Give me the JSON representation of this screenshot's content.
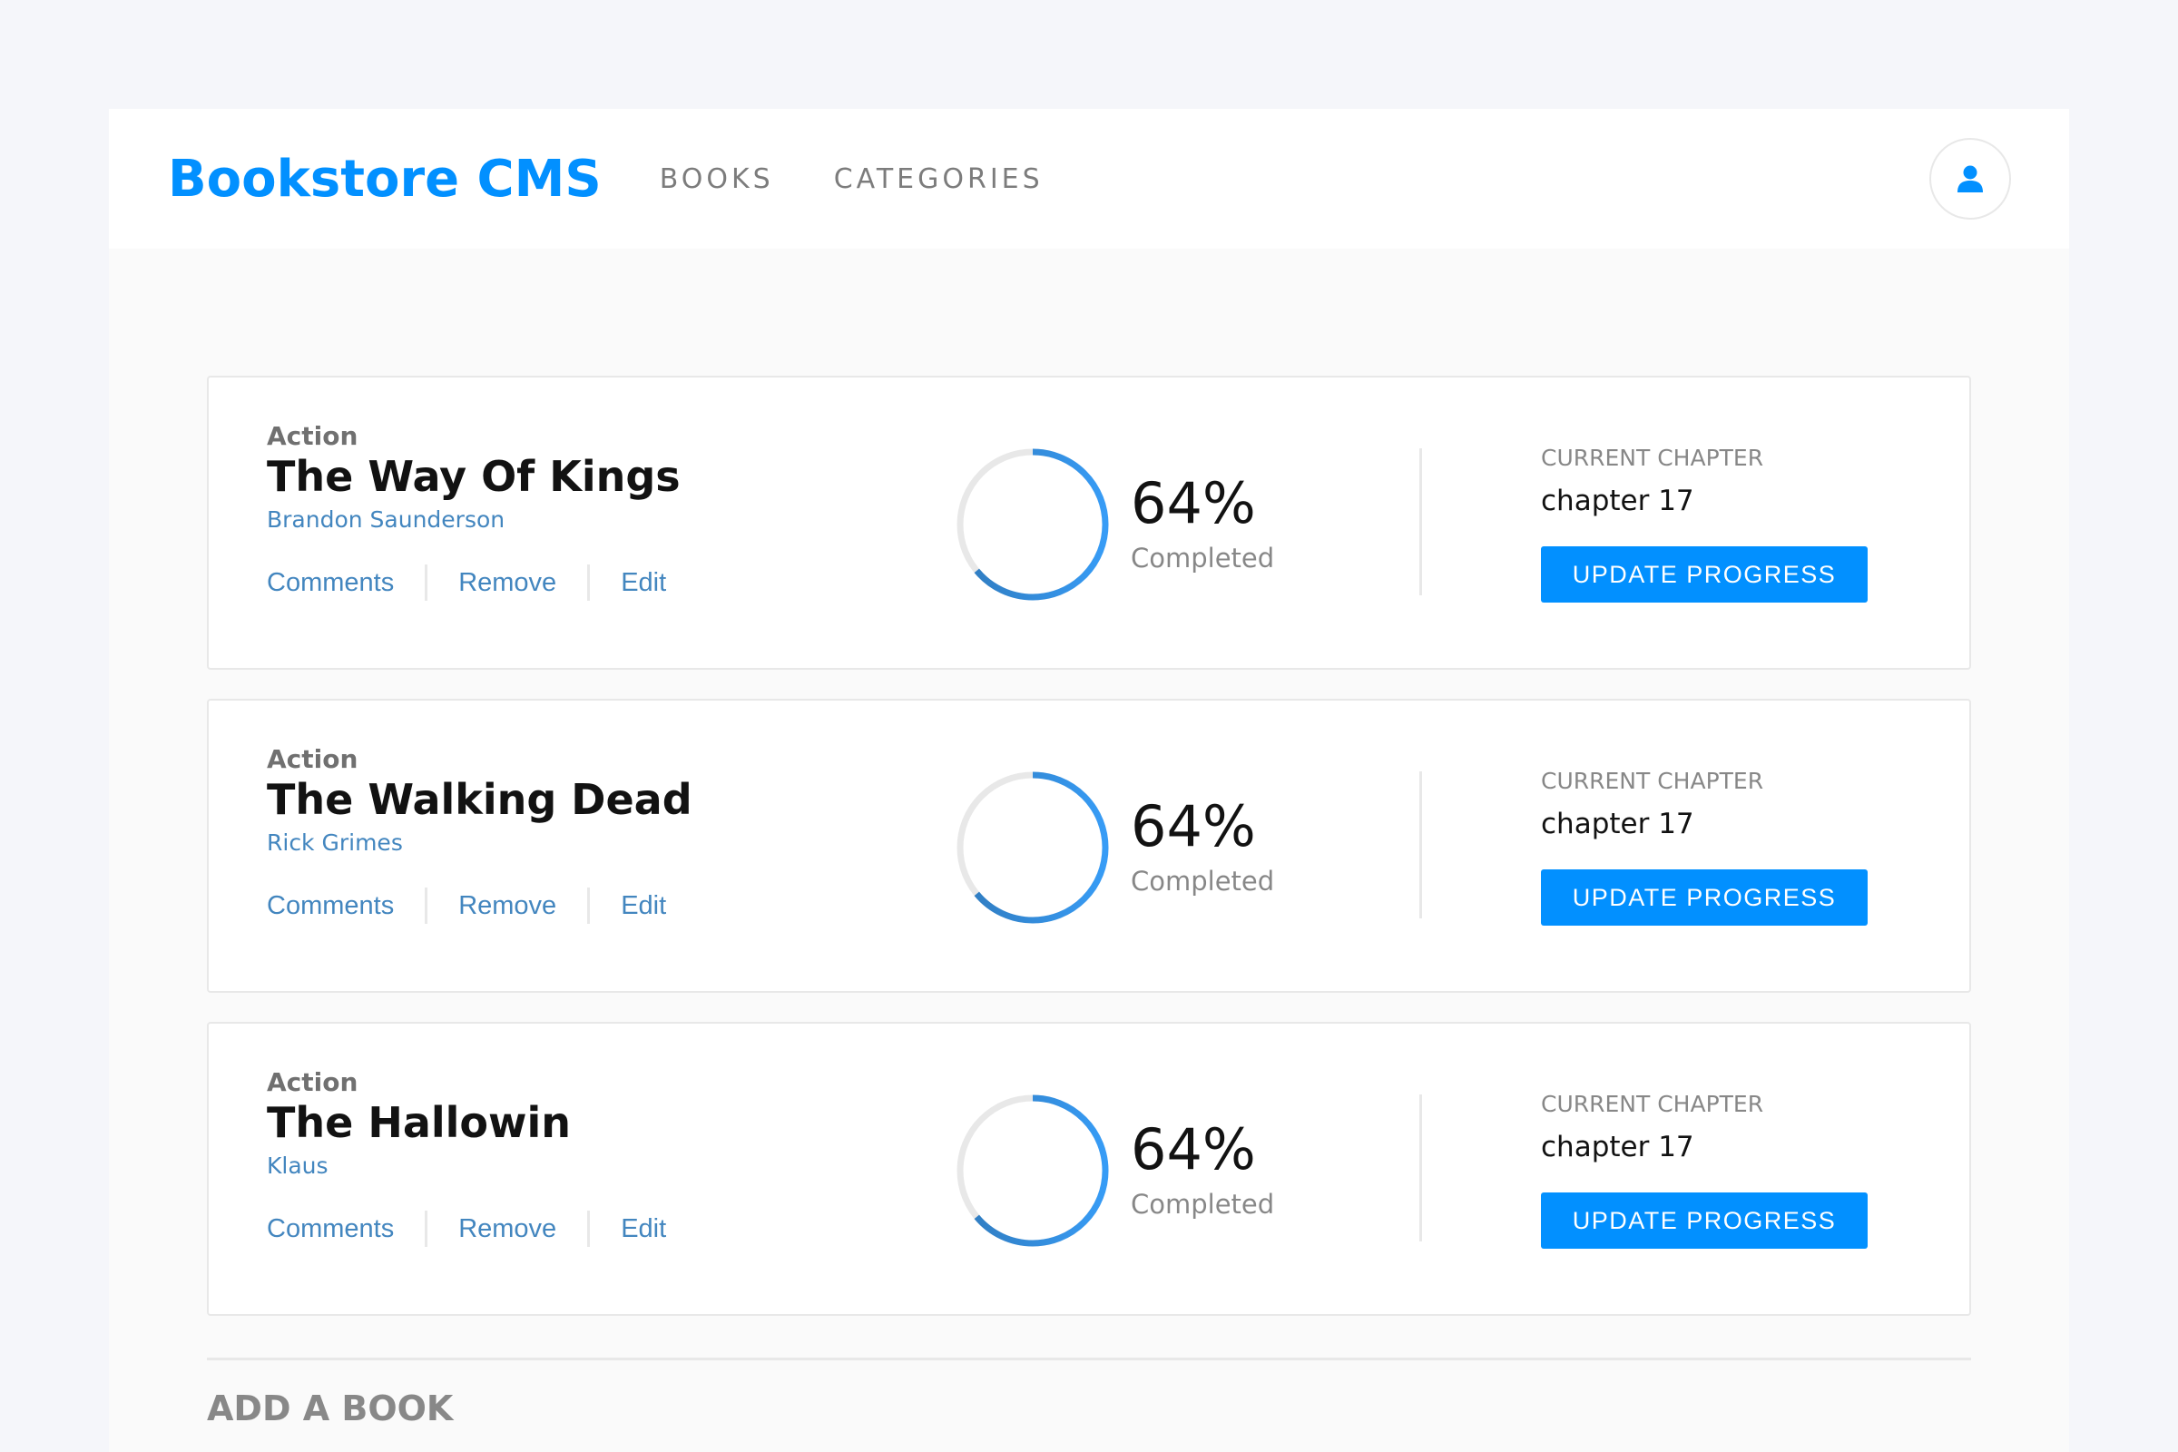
{
  "header": {
    "logo": "Bookstore CMS",
    "nav": [
      "BOOKS",
      "CATEGORIES"
    ],
    "user_icon": "user-icon"
  },
  "books": [
    {
      "genre": "Action",
      "title": "The Way Of Kings",
      "author": "Brandon Saunderson",
      "actions": [
        "Comments",
        "Remove",
        "Edit"
      ],
      "progress_percent": 64,
      "progress_label": "64%",
      "completed_label": "Completed",
      "chapter_label": "CURRENT CHAPTER",
      "chapter_value": "chapter 17",
      "update_label": "UPDATE PROGRESS"
    },
    {
      "genre": "Action",
      "title": "The Walking Dead",
      "author": "Rick Grimes",
      "actions": [
        "Comments",
        "Remove",
        "Edit"
      ],
      "progress_percent": 64,
      "progress_label": "64%",
      "completed_label": "Completed",
      "chapter_label": "CURRENT CHAPTER",
      "chapter_value": "chapter 17",
      "update_label": "UPDATE PROGRESS"
    },
    {
      "genre": "Action",
      "title": "The Hallowin",
      "author": "Klaus",
      "actions": [
        "Comments",
        "Remove",
        "Edit"
      ],
      "progress_percent": 64,
      "progress_label": "64%",
      "completed_label": "Completed",
      "chapter_label": "CURRENT CHAPTER",
      "chapter_value": "chapter 17",
      "update_label": "UPDATE PROGRESS"
    }
  ],
  "add_book": {
    "title": "ADD A BOOK"
  },
  "colors": {
    "accent": "#0290ff",
    "link": "#4386bf",
    "ring_track": "#e8e8e8",
    "ring_start": "#307bbe",
    "ring_end": "#379cf6"
  }
}
